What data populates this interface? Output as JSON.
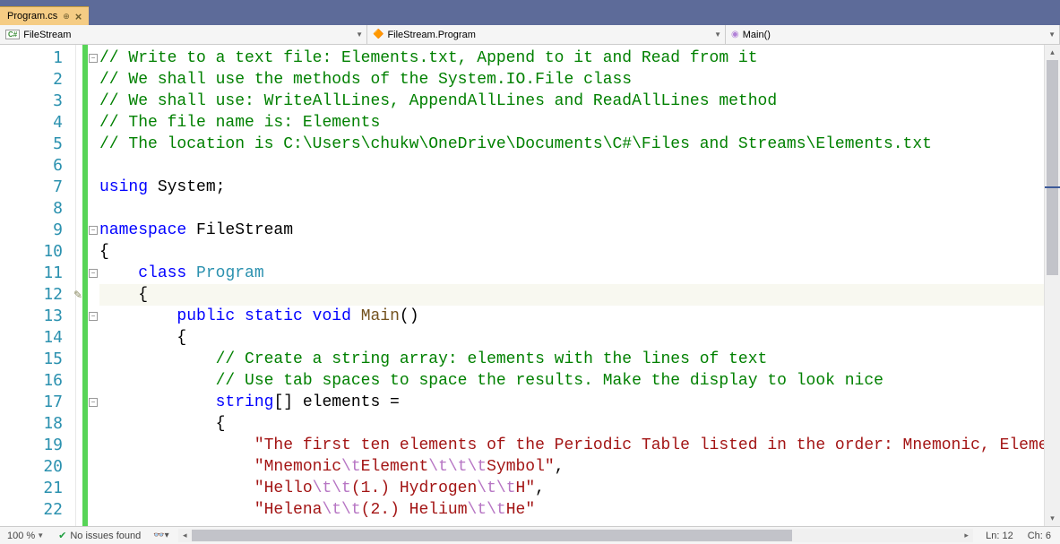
{
  "tab": {
    "label": "Program.cs"
  },
  "nav": {
    "ns": "FileStream",
    "class": "FileStream.Program",
    "method": "Main()"
  },
  "code": {
    "lines": [
      {
        "n": 1,
        "seg": [
          {
            "c": "c-comment",
            "t": "// Write to a text file: Elements.txt, Append to it and Read from it"
          }
        ]
      },
      {
        "n": 2,
        "seg": [
          {
            "c": "c-comment",
            "t": "// We shall use the methods of the System.IO.File class"
          }
        ]
      },
      {
        "n": 3,
        "seg": [
          {
            "c": "c-comment",
            "t": "// We shall use: WriteAllLines, AppendAllLines and ReadAllLines method"
          }
        ]
      },
      {
        "n": 4,
        "seg": [
          {
            "c": "c-comment",
            "t": "// The file name is: Elements"
          }
        ]
      },
      {
        "n": 5,
        "seg": [
          {
            "c": "c-comment",
            "t": "// The location is C:\\Users\\chukw\\OneDrive\\Documents\\C#\\Files and Streams\\Elements.txt"
          }
        ]
      },
      {
        "n": 6,
        "seg": []
      },
      {
        "n": 7,
        "seg": [
          {
            "c": "c-keyword",
            "t": "using"
          },
          {
            "c": "c-black",
            "t": " System;"
          }
        ]
      },
      {
        "n": 8,
        "seg": []
      },
      {
        "n": 9,
        "seg": [
          {
            "c": "c-keyword",
            "t": "namespace"
          },
          {
            "c": "c-black",
            "t": " FileStream"
          }
        ]
      },
      {
        "n": 10,
        "seg": [
          {
            "c": "c-black",
            "t": "{"
          }
        ]
      },
      {
        "n": 11,
        "seg": [
          {
            "c": "c-black",
            "t": "    "
          },
          {
            "c": "c-keyword",
            "t": "class"
          },
          {
            "c": "c-black",
            "t": " "
          },
          {
            "c": "c-type",
            "t": "Program"
          }
        ]
      },
      {
        "n": 12,
        "current": true,
        "seg": [
          {
            "c": "c-black",
            "t": "    {"
          }
        ]
      },
      {
        "n": 13,
        "seg": [
          {
            "c": "c-black",
            "t": "        "
          },
          {
            "c": "c-keyword",
            "t": "public"
          },
          {
            "c": "c-black",
            "t": " "
          },
          {
            "c": "c-keyword",
            "t": "static"
          },
          {
            "c": "c-black",
            "t": " "
          },
          {
            "c": "c-keyword",
            "t": "void"
          },
          {
            "c": "c-black",
            "t": " "
          },
          {
            "c": "c-method",
            "t": "Main"
          },
          {
            "c": "c-black",
            "t": "()"
          }
        ]
      },
      {
        "n": 14,
        "seg": [
          {
            "c": "c-black",
            "t": "        {"
          }
        ]
      },
      {
        "n": 15,
        "seg": [
          {
            "c": "c-black",
            "t": "            "
          },
          {
            "c": "c-comment",
            "t": "// Create a string array: elements with the lines of text"
          }
        ]
      },
      {
        "n": 16,
        "seg": [
          {
            "c": "c-black",
            "t": "            "
          },
          {
            "c": "c-comment",
            "t": "// Use tab spaces to space the results. Make the display to look nice"
          }
        ]
      },
      {
        "n": 17,
        "seg": [
          {
            "c": "c-black",
            "t": "            "
          },
          {
            "c": "c-keyword",
            "t": "string"
          },
          {
            "c": "c-black",
            "t": "[] elements ="
          }
        ]
      },
      {
        "n": 18,
        "seg": [
          {
            "c": "c-black",
            "t": "            {"
          }
        ]
      },
      {
        "n": 19,
        "seg": [
          {
            "c": "c-black",
            "t": "                "
          },
          {
            "c": "c-string",
            "t": "\"The first ten elements of the Periodic Table listed in the order: Mnemonic, Element, Symbol are:\""
          },
          {
            "c": "c-black",
            "t": ","
          }
        ]
      },
      {
        "n": 20,
        "seg": [
          {
            "c": "c-black",
            "t": "                "
          },
          {
            "c": "c-string",
            "t": "\"Mnemonic"
          },
          {
            "c": "c-escape",
            "t": "\\t"
          },
          {
            "c": "c-string",
            "t": "Element"
          },
          {
            "c": "c-escape",
            "t": "\\t\\t\\t"
          },
          {
            "c": "c-string",
            "t": "Symbol\""
          },
          {
            "c": "c-black",
            "t": ","
          }
        ]
      },
      {
        "n": 21,
        "seg": [
          {
            "c": "c-black",
            "t": "                "
          },
          {
            "c": "c-string",
            "t": "\"Hello"
          },
          {
            "c": "c-escape",
            "t": "\\t\\t"
          },
          {
            "c": "c-string",
            "t": "(1.) Hydrogen"
          },
          {
            "c": "c-escape",
            "t": "\\t\\t"
          },
          {
            "c": "c-string",
            "t": "H\""
          },
          {
            "c": "c-black",
            "t": ","
          }
        ]
      },
      {
        "n": 22,
        "seg": [
          {
            "c": "c-black",
            "t": "                "
          },
          {
            "c": "c-string",
            "t": "\"Helena"
          },
          {
            "c": "c-escape",
            "t": "\\t\\t"
          },
          {
            "c": "c-string",
            "t": "(2.) Helium"
          },
          {
            "c": "c-escape",
            "t": "\\t\\t"
          },
          {
            "c": "c-string",
            "t": "He\""
          }
        ]
      }
    ]
  },
  "folds": [
    1,
    9,
    11,
    13,
    17
  ],
  "editMarks": [
    12
  ],
  "status": {
    "zoom": "100 %",
    "issues": "No issues found",
    "ln": "Ln: 12",
    "ch": "Ch: 6"
  }
}
